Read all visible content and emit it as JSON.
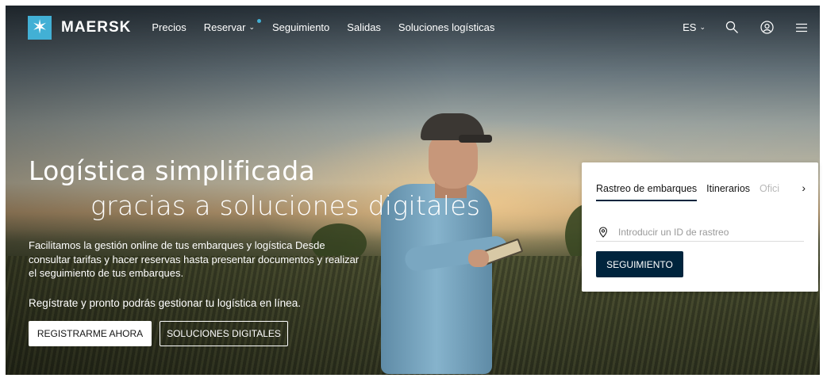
{
  "brand": {
    "logo_text": "MAERSK",
    "accent_color": "#42b0d5",
    "dark_color": "#00243d"
  },
  "nav": {
    "items": [
      {
        "label": "Precios",
        "has_dropdown": false
      },
      {
        "label": "Reservar",
        "has_dropdown": true,
        "has_dot": true
      },
      {
        "label": "Seguimiento",
        "has_dropdown": false
      },
      {
        "label": "Salidas",
        "has_dropdown": false
      },
      {
        "label": "Soluciones logísticas",
        "has_dropdown": false
      }
    ],
    "language": "ES",
    "icons": [
      "search-icon",
      "user-icon",
      "menu-icon"
    ]
  },
  "hero": {
    "headline_line1": "Logística simplificada",
    "headline_line2": "gracias a soluciones digitales",
    "description": "Facilitamos la gestión online de tus embarques y logística Desde consultar tarifas y hacer reservas hasta presentar documentos y realizar el seguimiento de tus embarques.",
    "cta_text": "Regístrate y pronto podrás gestionar tu logística en línea.",
    "primary_button": "REGISTRARME AHORA",
    "secondary_button": "SOLUCIONES DIGITALES"
  },
  "tracking": {
    "tabs": [
      "Rastreo de embarques",
      "Itinerarios",
      "Ofici"
    ],
    "active_tab": 0,
    "input_placeholder": "Introducir un ID de rastreo",
    "input_value": "",
    "button": "SEGUIMIENTO"
  }
}
